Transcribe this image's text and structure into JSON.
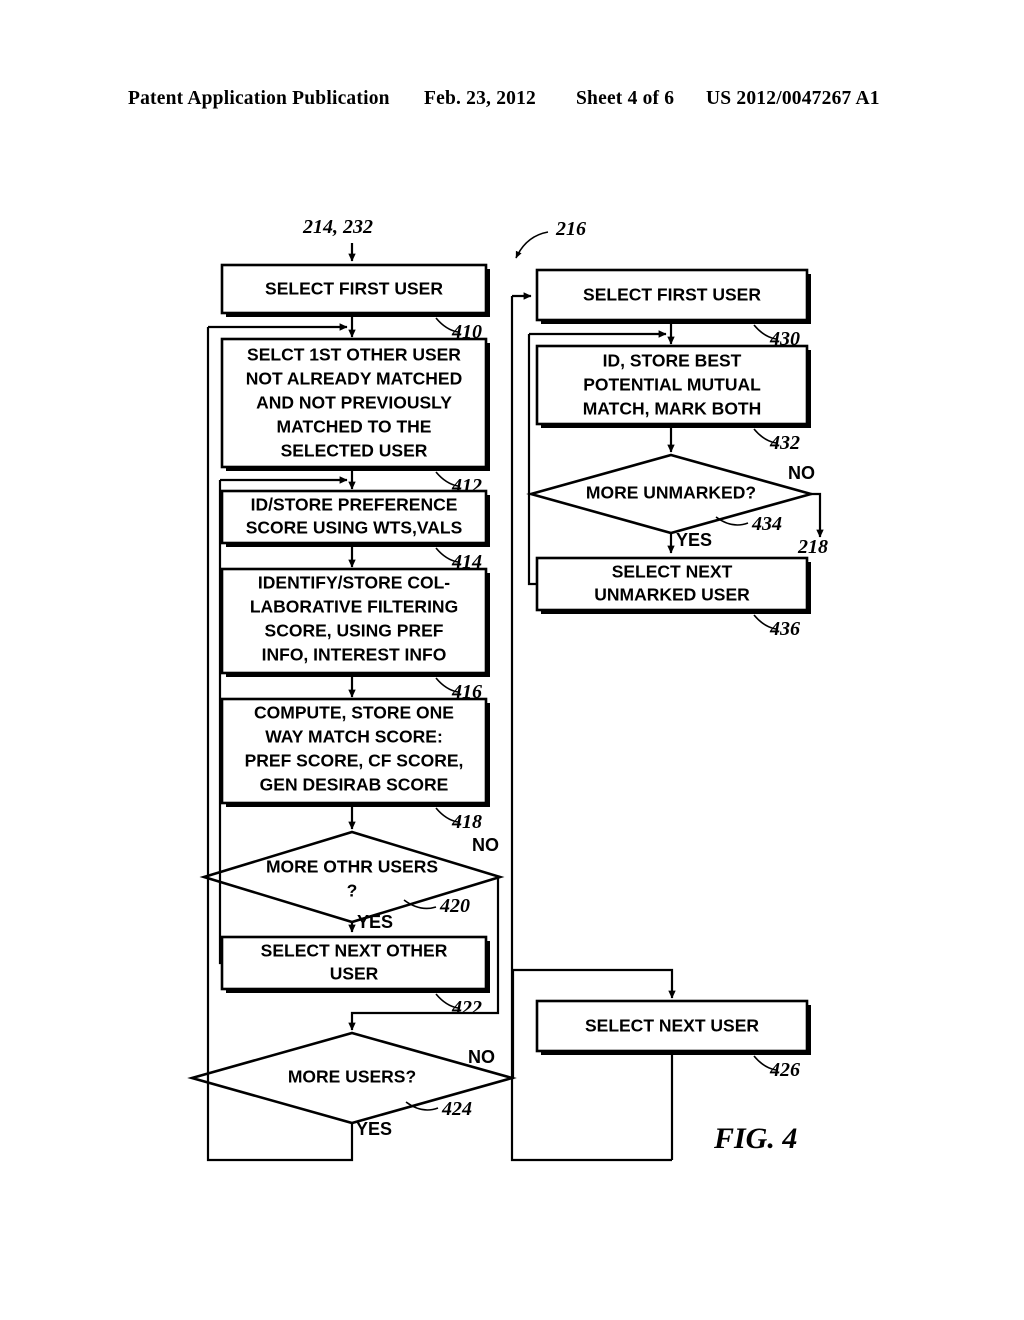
{
  "header": {
    "title": "Patent Application Publication",
    "date": "Feb. 23, 2012",
    "sheet": "Sheet 4 of 6",
    "number": "US 2012/0047267 A1"
  },
  "figure": {
    "label": "FIG. 4",
    "entry_labels": {
      "left": "214, 232",
      "right": "216",
      "exit": "218"
    },
    "nodes": [
      {
        "id": "410",
        "ref": "410",
        "shape": "process",
        "lines": [
          "SELECT FIRST USER"
        ]
      },
      {
        "id": "412",
        "ref": "412",
        "shape": "process",
        "lines": [
          "SELCT 1ST OTHER USER",
          "NOT ALREADY MATCHED",
          "AND NOT PREVIOUSLY",
          "MATCHED TO THE",
          "SELECTED USER"
        ]
      },
      {
        "id": "414",
        "ref": "414",
        "shape": "process",
        "lines": [
          "ID/STORE PREFERENCE",
          "SCORE USING WTS,VALS"
        ]
      },
      {
        "id": "416",
        "ref": "416",
        "shape": "process",
        "lines": [
          "IDENTIFY/STORE COL-",
          "LABORATIVE FILTERING",
          "SCORE,  USING PREF",
          "INFO, INTEREST INFO"
        ]
      },
      {
        "id": "418",
        "ref": "418",
        "shape": "process",
        "lines": [
          "COMPUTE, STORE ONE",
          "WAY MATCH SCORE:",
          "PREF SCORE, CF SCORE,",
          "GEN DESIRAB SCORE"
        ]
      },
      {
        "id": "420",
        "ref": "420",
        "shape": "decision",
        "lines": [
          "MORE OTHR USERS",
          "?"
        ]
      },
      {
        "id": "422",
        "ref": "422",
        "shape": "process",
        "lines": [
          "SELECT NEXT OTHER",
          "USER"
        ]
      },
      {
        "id": "424",
        "ref": "424",
        "shape": "decision",
        "lines": [
          "MORE USERS?"
        ]
      },
      {
        "id": "426",
        "ref": "426",
        "shape": "process",
        "lines": [
          "SELECT NEXT USER"
        ]
      },
      {
        "id": "430",
        "ref": "430",
        "shape": "process",
        "lines": [
          "SELECT FIRST USER"
        ]
      },
      {
        "id": "432",
        "ref": "432",
        "shape": "process",
        "lines": [
          "ID, STORE BEST",
          "POTENTIAL MUTUAL",
          "MATCH, MARK BOTH"
        ]
      },
      {
        "id": "434",
        "ref": "434",
        "shape": "decision",
        "lines": [
          "MORE UNMARKED?"
        ]
      },
      {
        "id": "436",
        "ref": "436",
        "shape": "process",
        "lines": [
          "SELECT NEXT",
          "UNMARKED USER"
        ]
      }
    ],
    "branch_labels": {
      "b420_no": "NO",
      "b420_yes": "YES",
      "b424_no": "NO",
      "b424_yes": "YES",
      "b434_no": "NO",
      "b434_yes": "YES"
    }
  }
}
